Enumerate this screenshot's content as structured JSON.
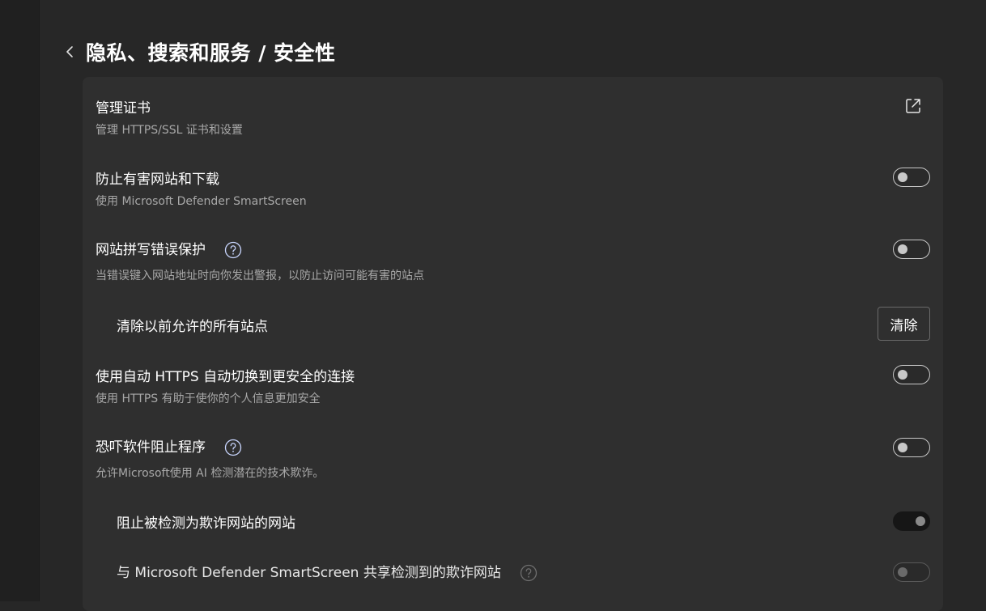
{
  "header": {
    "title": "隐私、搜索和服务 / 安全性"
  },
  "settings": {
    "manage_certs": {
      "title": "管理证书",
      "desc": "管理 HTTPS/SSL 证书和设置"
    },
    "smartscreen": {
      "title": "防止有害网站和下载",
      "desc": "使用 Microsoft Defender SmartScreen",
      "enabled": false
    },
    "typo_protection": {
      "title": "网站拼写错误保护",
      "desc": "当错误键入网站地址时向你发出警报，以防止访问可能有害的站点",
      "enabled": false
    },
    "clear_sites": {
      "title": "清除以前允许的所有站点",
      "button_label": "清除"
    },
    "auto_https": {
      "title": "使用自动 HTTPS 自动切换到更安全的连接",
      "desc": "使用 HTTPS 有助于使你的个人信息更加安全",
      "enabled": false
    },
    "scareware_blocker": {
      "title": "恐吓软件阻止程序",
      "desc": "允许Microsoft使用 AI 检测潜在的技术欺诈。",
      "enabled": false
    },
    "block_scam_sites": {
      "title": "阻止被检测为欺诈网站的网站",
      "enabled": true
    },
    "share_with_smartscreen": {
      "title": "与 Microsoft Defender SmartScreen 共享检测到的欺诈网站",
      "enabled": false
    }
  },
  "colors": {
    "background": "#272727",
    "card": "#2f2f2f",
    "text_primary": "#ffffff",
    "text_secondary": "#a8a8a8",
    "help_icon": "#c9d6ff"
  },
  "icons": {
    "back": "chevron-left-icon",
    "external": "open-external-icon",
    "help": "question-circle-icon"
  }
}
